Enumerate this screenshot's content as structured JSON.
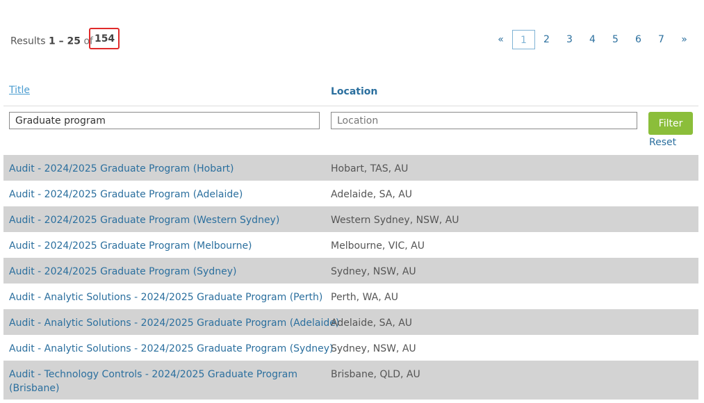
{
  "results": {
    "label": "Results",
    "range": "1 – 25",
    "of_label": "of",
    "total": "154"
  },
  "pagination": {
    "prev": "«",
    "pages": [
      "1",
      "2",
      "3",
      "4",
      "5",
      "6",
      "7"
    ],
    "active_page": "1",
    "next": "»"
  },
  "table": {
    "headers": {
      "title": "Title",
      "location": "Location"
    },
    "filters": {
      "title_value": "Graduate program",
      "location_placeholder": "Location",
      "filter_button": "Filter",
      "reset_link": "Reset"
    },
    "rows": [
      {
        "title": "Audit - 2024/2025 Graduate Program (Hobart)",
        "location": "Hobart, TAS, AU"
      },
      {
        "title": "Audit - 2024/2025 Graduate Program (Adelaide)",
        "location": "Adelaide, SA, AU"
      },
      {
        "title": "Audit - 2024/2025 Graduate Program (Western Sydney)",
        "location": "Western Sydney, NSW, AU"
      },
      {
        "title": "Audit - 2024/2025 Graduate Program (Melbourne)",
        "location": "Melbourne, VIC, AU"
      },
      {
        "title": "Audit - 2024/2025 Graduate Program (Sydney)",
        "location": "Sydney, NSW, AU"
      },
      {
        "title": "Audit - Analytic Solutions - 2024/2025 Graduate Program (Perth)",
        "location": "Perth, WA, AU"
      },
      {
        "title": "Audit - Analytic Solutions - 2024/2025 Graduate Program (Adelaide)",
        "location": "Adelaide, SA, AU"
      },
      {
        "title": "Audit - Analytic Solutions - 2024/2025 Graduate Program (Sydney)",
        "location": "Sydney, NSW, AU"
      },
      {
        "title": "Audit - Technology Controls - 2024/2025 Graduate Program (Brisbane)",
        "location": "Brisbane, QLD, AU"
      }
    ]
  },
  "colors": {
    "link": "#2b6f9e",
    "filter_button": "#8bbe3a",
    "row_shade": "#d3d3d3",
    "highlight_box": "#e02a2a"
  }
}
